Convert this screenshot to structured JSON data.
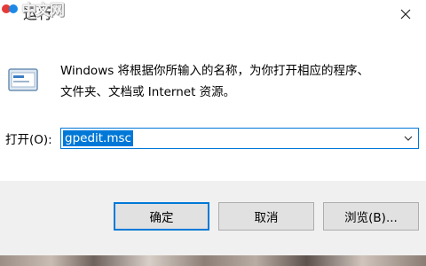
{
  "window": {
    "title": "运行",
    "watermark": "中文网",
    "close_icon": "close-icon"
  },
  "description": {
    "line1": "Windows 将根据你所输入的名称，为你打开相应的程序、",
    "line2": "文件夹、文档或 Internet 资源。"
  },
  "open_field": {
    "label": "打开(O):",
    "value": "gpedit.msc"
  },
  "buttons": {
    "ok": "确定",
    "cancel": "取消",
    "browse": "浏览(B)..."
  },
  "colors": {
    "accent": "#0078d7",
    "footer_bg": "#f0f0f0",
    "button_bg": "#e1e1e1"
  }
}
